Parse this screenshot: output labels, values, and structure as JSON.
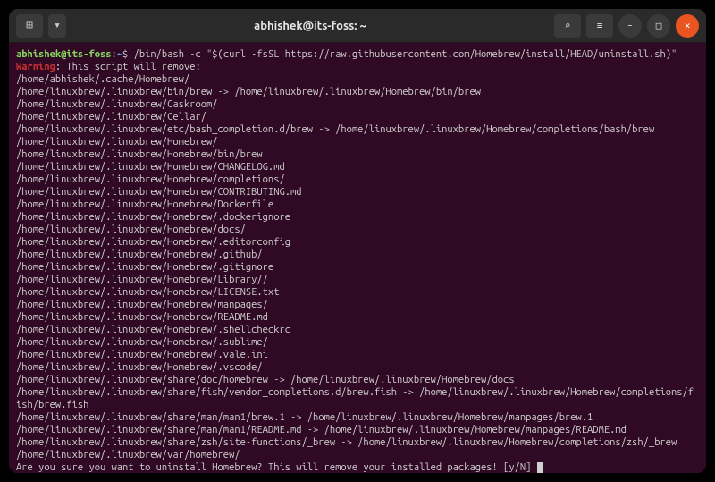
{
  "window": {
    "title": "abhishek@its-foss: ~",
    "newtab_icon": "⊞",
    "dropdown_icon": "▾",
    "search_icon": "⌕",
    "menu_icon": "≡",
    "min_icon": "–",
    "max_icon": "□",
    "close_icon": "✕"
  },
  "prompt": {
    "user_host": "abhishek@its-foss",
    "sep": ":",
    "path": "~",
    "dollar": "$ "
  },
  "command": "/bin/bash -c \"$(curl -fsSL https://raw.githubusercontent.com/Homebrew/install/HEAD/uninstall.sh)\"",
  "warning": {
    "label": "Warning",
    "text": ": This script will remove:"
  },
  "lines": [
    "/home/abhishek/.cache/Homebrew/",
    "/home/linuxbrew/.linuxbrew/bin/brew -> /home/linuxbrew/.linuxbrew/Homebrew/bin/brew",
    "/home/linuxbrew/.linuxbrew/Caskroom/",
    "/home/linuxbrew/.linuxbrew/Cellar/",
    "/home/linuxbrew/.linuxbrew/etc/bash_completion.d/brew -> /home/linuxbrew/.linuxbrew/Homebrew/completions/bash/brew",
    "/home/linuxbrew/.linuxbrew/Homebrew/",
    "/home/linuxbrew/.linuxbrew/Homebrew/bin/brew",
    "/home/linuxbrew/.linuxbrew/Homebrew/CHANGELOG.md",
    "/home/linuxbrew/.linuxbrew/Homebrew/completions/",
    "/home/linuxbrew/.linuxbrew/Homebrew/CONTRIBUTING.md",
    "/home/linuxbrew/.linuxbrew/Homebrew/Dockerfile",
    "/home/linuxbrew/.linuxbrew/Homebrew/.dockerignore",
    "/home/linuxbrew/.linuxbrew/Homebrew/docs/",
    "/home/linuxbrew/.linuxbrew/Homebrew/.editorconfig",
    "/home/linuxbrew/.linuxbrew/Homebrew/.github/",
    "/home/linuxbrew/.linuxbrew/Homebrew/.gitignore",
    "/home/linuxbrew/.linuxbrew/Homebrew/Library//",
    "/home/linuxbrew/.linuxbrew/Homebrew/LICENSE.txt",
    "/home/linuxbrew/.linuxbrew/Homebrew/manpages/",
    "/home/linuxbrew/.linuxbrew/Homebrew/README.md",
    "/home/linuxbrew/.linuxbrew/Homebrew/.shellcheckrc",
    "/home/linuxbrew/.linuxbrew/Homebrew/.sublime/",
    "/home/linuxbrew/.linuxbrew/Homebrew/.vale.ini",
    "/home/linuxbrew/.linuxbrew/Homebrew/.vscode/",
    "/home/linuxbrew/.linuxbrew/share/doc/homebrew -> /home/linuxbrew/.linuxbrew/Homebrew/docs",
    "/home/linuxbrew/.linuxbrew/share/fish/vendor_completions.d/brew.fish -> /home/linuxbrew/.linuxbrew/Homebrew/completions/fish/brew.fish",
    "/home/linuxbrew/.linuxbrew/share/man/man1/brew.1 -> /home/linuxbrew/.linuxbrew/Homebrew/manpages/brew.1",
    "/home/linuxbrew/.linuxbrew/share/man/man1/README.md -> /home/linuxbrew/.linuxbrew/Homebrew/manpages/README.md",
    "/home/linuxbrew/.linuxbrew/share/zsh/site-functions/_brew -> /home/linuxbrew/.linuxbrew/Homebrew/completions/zsh/_brew",
    "/home/linuxbrew/.linuxbrew/var/homebrew/"
  ],
  "confirm": "Are you sure you want to uninstall Homebrew? This will remove your installed packages! [y/N] "
}
